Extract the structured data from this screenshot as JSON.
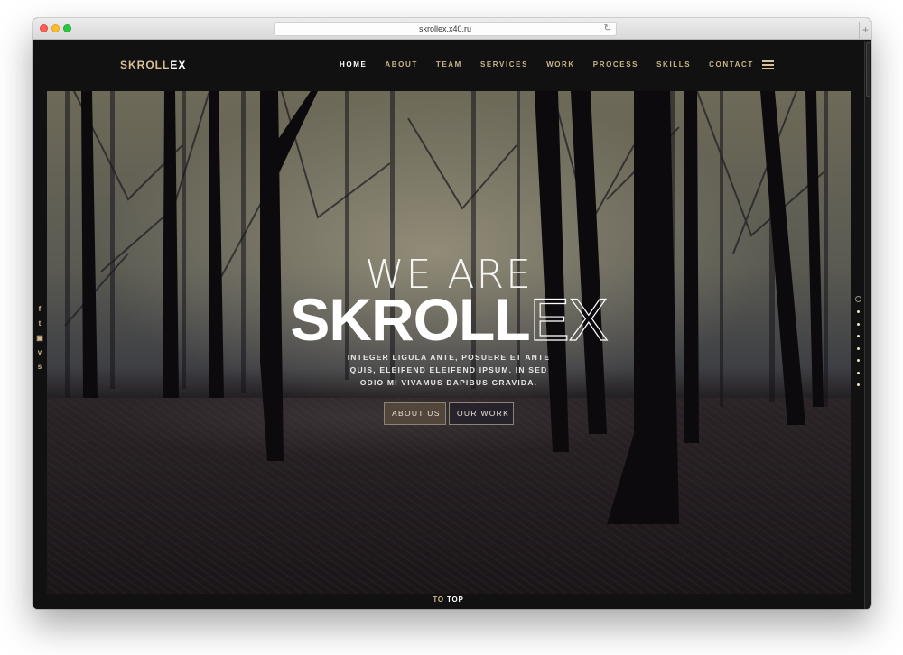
{
  "browser": {
    "url": "skrollex.x40.ru",
    "reload_icon": "↻",
    "new_tab_icon": "+"
  },
  "nav": {
    "logo_a": "SKROLL",
    "logo_b": "EX",
    "items": [
      {
        "label": "HOME",
        "active": true
      },
      {
        "label": "ABOUT",
        "active": false
      },
      {
        "label": "TEAM",
        "active": false
      },
      {
        "label": "SERVICES",
        "active": false
      },
      {
        "label": "WORK",
        "active": false
      },
      {
        "label": "PROCESS",
        "active": false
      },
      {
        "label": "SKILLS",
        "active": false
      },
      {
        "label": "CONTACT",
        "active": false
      }
    ],
    "menu_icon": "hamburger-icon"
  },
  "hero": {
    "we_are": "WE ARE",
    "brand_bold": "SKROLL",
    "brand_outline": "EX",
    "tagline": "INTEGER LIGULA ANTE, POSUERE ET ANTE QUIS, ELEIFEND ELEIFEND IPSUM. IN SED ODIO MI VIVAMUS DAPIBUS GRAVIDA.",
    "buttons": {
      "about": "ABOUT US",
      "work": "OUR WORK"
    }
  },
  "social": [
    {
      "name": "facebook-icon",
      "glyph": "f"
    },
    {
      "name": "twitter-icon",
      "glyph": "t"
    },
    {
      "name": "youtube-icon",
      "glyph": "▣"
    },
    {
      "name": "vimeo-icon",
      "glyph": "v"
    },
    {
      "name": "skype-icon",
      "glyph": "s"
    }
  ],
  "section_dots": {
    "count": 8,
    "active_index": 0
  },
  "footer": {
    "to": "TO",
    "top": "TOP"
  },
  "colors": {
    "accent": "#cdb48a",
    "background": "#111111"
  }
}
